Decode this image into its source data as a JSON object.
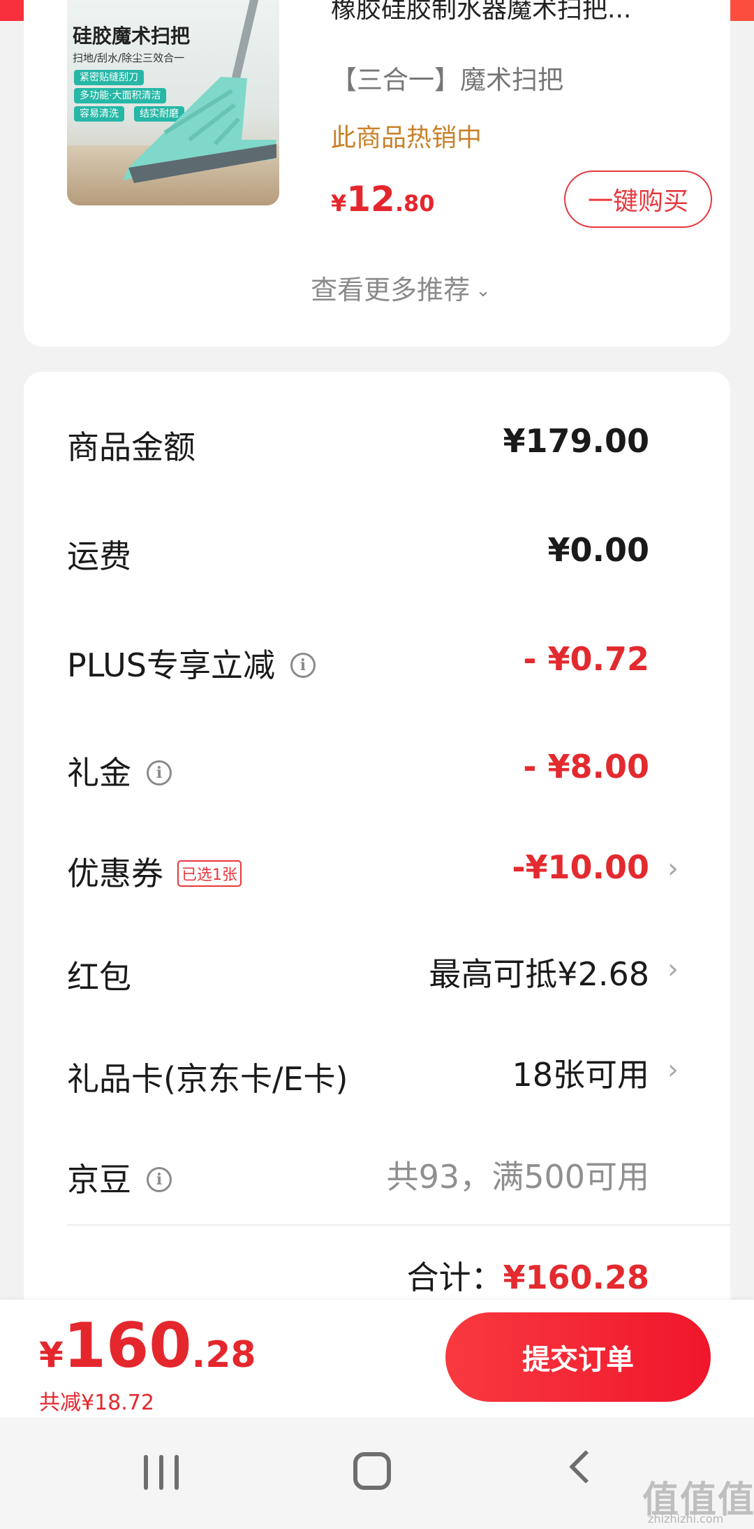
{
  "product": {
    "name_cut": "橡胶硅胶制水器魔术扫把...",
    "thumb_title": "硅胶魔术扫把",
    "thumb_subtitle": "扫地/刮水/除尘三效合一",
    "thumb_tags": [
      "紧密贴缝刮刀",
      "多功能·大面积清洁",
      "容易清洗",
      "结实耐磨"
    ],
    "spec": "【三合一】魔术扫把",
    "hot_label": "此商品热销中",
    "price_currency": "¥",
    "price_int": "12",
    "price_dec": ".80",
    "buy_button": "一键购买"
  },
  "more_recs": {
    "label": "查看更多推荐",
    "chevron": "⌄"
  },
  "cost_rows": [
    {
      "label": "商品金额",
      "value": "¥179.00"
    },
    {
      "label": "运费",
      "value": "¥0.00"
    },
    {
      "label": "PLUS专享立减",
      "value": "- ¥0.72",
      "info_icon": "i"
    },
    {
      "label": "礼金",
      "value": "- ¥8.00",
      "info_icon": "i"
    },
    {
      "label": "优惠券",
      "tag": "已选1张",
      "value": "-¥10.00",
      "chevron": "›"
    },
    {
      "label": "红包",
      "value": "最高可抵¥2.68",
      "chevron": "›"
    },
    {
      "label": "礼品卡(京东卡/E卡)",
      "value": "18张可用",
      "chevron": "›"
    },
    {
      "label": "京豆",
      "value": "共93，满500可用",
      "info_icon": "i"
    }
  ],
  "total": {
    "label": "合计：",
    "value": "¥160.28"
  },
  "bottom_bar": {
    "price_currency": "¥",
    "price_int": "160",
    "price_dec": ".28",
    "saved": "共减¥18.72",
    "submit": "提交订单"
  },
  "nav": {
    "recents": "recents-icon",
    "home": "home-icon",
    "back": "back-icon"
  },
  "watermark": {
    "text": "值值值",
    "url": "zhizhizhi.com"
  },
  "colors": {
    "accent_red": "#e4272d",
    "hot_orange": "#c8812a",
    "tag_teal": "#26b7a6"
  }
}
